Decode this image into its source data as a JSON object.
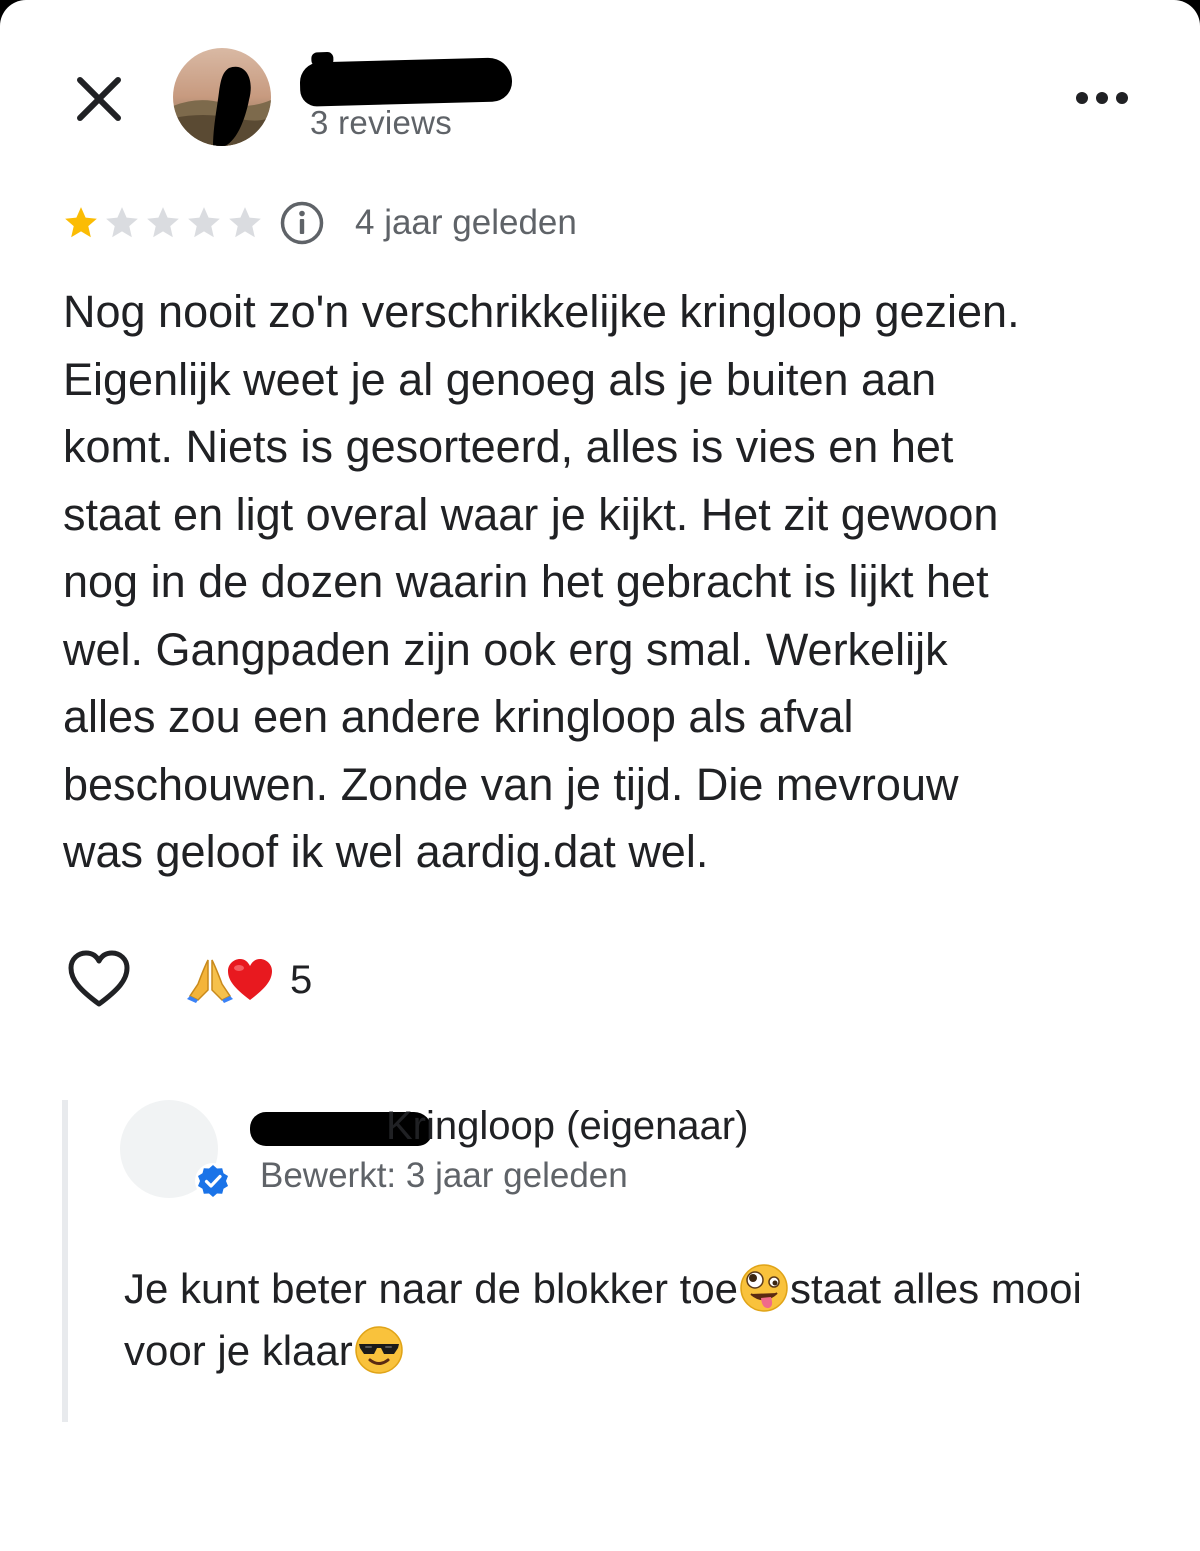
{
  "colors": {
    "star_filled": "#fbbc04",
    "star_empty": "#dadce0",
    "text_primary": "#202124",
    "text_secondary": "#5f6368",
    "verified_blue": "#1a73e8"
  },
  "header": {
    "close_icon": "close-icon",
    "review_count": "3 reviews",
    "more_icon": "more-horizontal-icon"
  },
  "review": {
    "rating": 1,
    "max_rating": 5,
    "date": "4 jaar geleden",
    "text": "Nog nooit zo'n verschrikkelijke kringloop gezien.\nEigenlijk weet je al genoeg als je buiten aan\nkomt. Niets is gesorteerd, alles is vies en het\nstaat en ligt overal waar je kijkt. Het zit gewoon\nnog in de dozen waarin het gebracht is lijkt het\nwel. Gangpaden zijn ook erg smal. Werkelijk\nalles zou een andere kringloop als afval\nbeschouwen. Zonde van je tijd. Die mevrouw\nwas geloof ik wel aardig.dat wel.",
    "reactions": {
      "emojis": [
        "🙏",
        "❤️"
      ],
      "count": "5"
    }
  },
  "owner_reply": {
    "name_suffix": "Kringloop (eigenaar)",
    "date": "Bewerkt: 3 jaar geleden",
    "text_part1": "Je kunt beter naar de blokker toe",
    "emoji1": "🤪",
    "text_part2": "staat alles mooi voor je klaar",
    "emoji2": "😎"
  }
}
